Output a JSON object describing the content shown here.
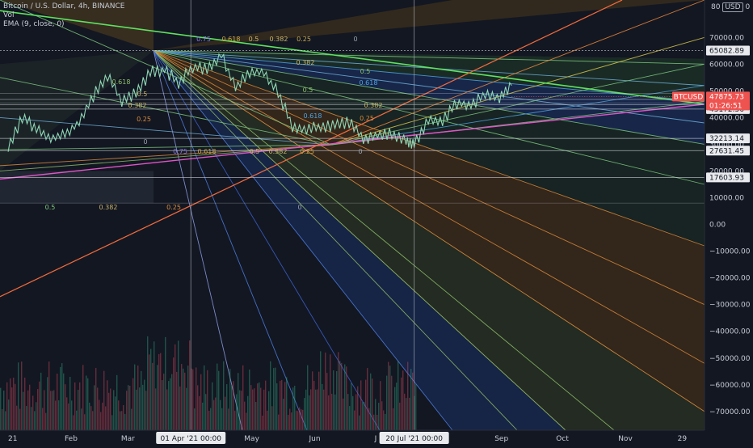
{
  "legend": {
    "symbol": "Bitcoin / U.S. Dollar, 4h, BINANCE",
    "vol": "Vol",
    "ema": "EMA (9, close, 0)"
  },
  "top_right": {
    "value": "80",
    "currency": "USD",
    "zero": "0"
  },
  "colors": {
    "background": "#131722",
    "candle_up": "#2e9e7c",
    "candle_down": "#c9485b",
    "last_price": "#ef5350",
    "axis_text": "#c8ccd6"
  },
  "chart_data": {
    "type": "line",
    "title": "Bitcoin / U.S. Dollar, 4h, BINANCE",
    "y_ticks": [
      "70000.00",
      "60000.00",
      "50000.00",
      "40000.00",
      "30000.00",
      "20000.00",
      "10000.00",
      "0.00",
      "−10000.00",
      "−20000.00",
      "−30000.00",
      "−40000.00",
      "−50000.00",
      "−60000.00",
      "−70000.00"
    ],
    "y_tick_values": [
      70000,
      60000,
      50000,
      40000,
      30000,
      20000,
      10000,
      0,
      -10000,
      -20000,
      -30000,
      -40000,
      -50000,
      -60000,
      -70000
    ],
    "ylim": [
      -77000,
      84000
    ],
    "x_ticks": [
      "21",
      "Feb",
      "Mar",
      "May",
      "Jun",
      "J",
      "Sep",
      "Oct",
      "Nov",
      "29"
    ],
    "x_tick_dates": [
      "2021-01-01",
      "2021-02-01",
      "2021-03-01",
      "2021-05-01",
      "2021-06-01",
      "2021-07-01",
      "2021-09-01",
      "2021-10-01",
      "2021-11-01",
      "2021-11-29"
    ],
    "xlim": [
      "2020-12-28",
      "2021-12-10"
    ],
    "crosshair_x": [
      {
        "label": "01 Apr '21   00:00",
        "date": "2021-04-01"
      },
      {
        "label": "20 Jul '21   00:00",
        "date": "2021-07-20"
      }
    ],
    "price_tags": [
      {
        "label": "65082.89",
        "value": 65082.89
      },
      {
        "label": "46792.30",
        "value": 46792.3
      },
      {
        "label": "44785.86",
        "value": 44785.86
      },
      {
        "label": "43172.56",
        "value": 43172.56
      },
      {
        "label": "32213.14",
        "value": 32213.14
      },
      {
        "label": "27631.45",
        "value": 27631.45
      },
      {
        "label": "17603.93",
        "value": 17603.93
      }
    ],
    "last_price": {
      "symbol": "BTCUSD",
      "value": 47875.73,
      "label": "47875.73",
      "countdown": "01:26:51"
    },
    "fib_levels_top": [
      "0.75",
      "0.618",
      "0.5",
      "0.382",
      "0.25",
      "0"
    ],
    "fib_levels_bottom": [
      "0.75",
      "0.618",
      "0.5",
      "0.382",
      "0.25",
      "0"
    ],
    "fib_levels_left": [
      "0.5",
      "0.382",
      "0.25",
      "0"
    ],
    "series": [
      {
        "dates": [
          "2021-01-01",
          "2021-01-08",
          "2021-01-15",
          "2021-01-22",
          "2021-01-29",
          "2021-02-05",
          "2021-02-12",
          "2021-02-19",
          "2021-02-26",
          "2021-03-05",
          "2021-03-12",
          "2021-03-19",
          "2021-03-26",
          "2021-04-02",
          "2021-04-09",
          "2021-04-16",
          "2021-04-23",
          "2021-04-30",
          "2021-05-07",
          "2021-05-14",
          "2021-05-21",
          "2021-05-28",
          "2021-06-04",
          "2021-06-11",
          "2021-06-18",
          "2021-06-25",
          "2021-07-02",
          "2021-07-09",
          "2021-07-16",
          "2021-07-20",
          "2021-07-27",
          "2021-08-03",
          "2021-08-10",
          "2021-08-17",
          "2021-08-24",
          "2021-08-31",
          "2021-09-06"
        ],
        "values": [
          29000,
          40000,
          36000,
          32000,
          34000,
          38000,
          48000,
          56000,
          46000,
          49000,
          57000,
          58000,
          53000,
          59000,
          58000,
          63500,
          51000,
          57000,
          57000,
          49000,
          37000,
          35500,
          36500,
          37000,
          38000,
          32000,
          33500,
          34000,
          31700,
          29800,
          39500,
          38500,
          45500,
          45000,
          48500,
          47500,
          52000
        ]
      }
    ]
  }
}
